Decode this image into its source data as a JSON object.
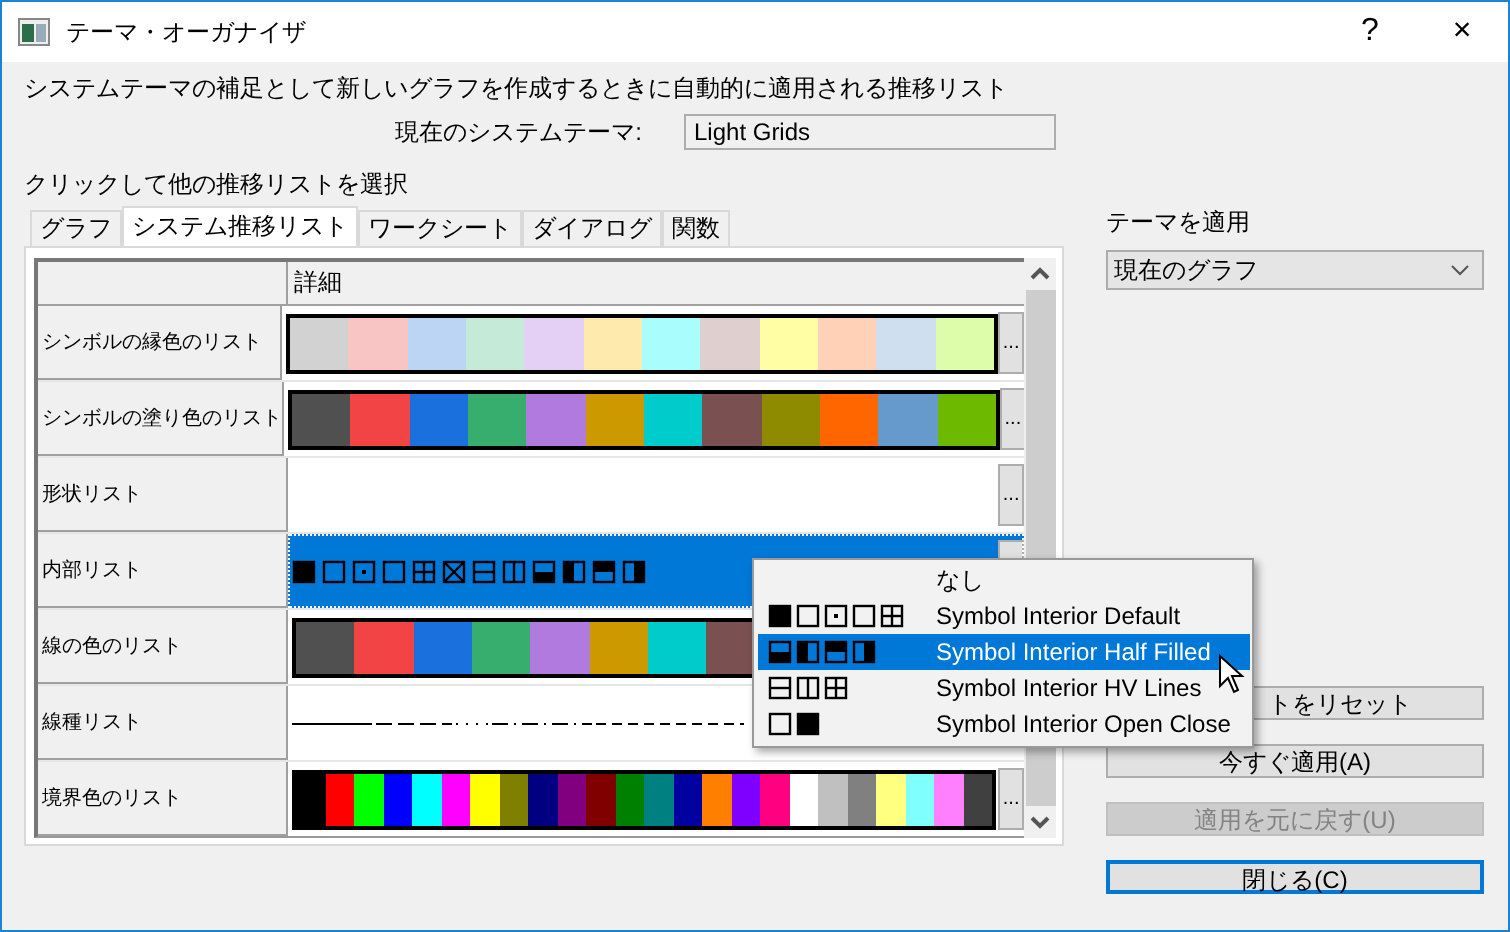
{
  "window": {
    "title": "テーマ・オーガナイザ",
    "help": "?",
    "close": "×"
  },
  "description": "システムテーマの補足として新しいグラフを作成するときに自動的に適用される推移リスト",
  "current_theme": {
    "label": "現在のシステムテーマ:",
    "value": "Light Grids"
  },
  "instruction": "クリックして他の推移リストを選択",
  "tabs": [
    {
      "label": "グラフ",
      "selected": false
    },
    {
      "label": "システム推移リスト",
      "selected": true
    },
    {
      "label": "ワークシート",
      "selected": false
    },
    {
      "label": "ダイアログ",
      "selected": false
    },
    {
      "label": "関数",
      "selected": false
    }
  ],
  "table": {
    "columns": [
      "詳細"
    ],
    "rows": [
      {
        "name": "シンボルの縁色のリスト",
        "kind": "colors",
        "selected": false,
        "more": "...",
        "swatches": [
          {
            "color": "#d2d2d2"
          },
          {
            "color": "#f9c4c4"
          },
          {
            "color": "#bcd5f4"
          },
          {
            "color": "#c5ead7"
          },
          {
            "color": "#e3d0f4"
          },
          {
            "color": "#feeaad"
          },
          {
            "color": "#a9fdfd"
          },
          {
            "color": "#dfcfcf"
          },
          {
            "color": "#fffea4"
          },
          {
            "color": "#ffd2b8"
          },
          {
            "color": "#d0dff0"
          },
          {
            "color": "#ddfdaa"
          }
        ]
      },
      {
        "name": "シンボルの塗り色のリスト",
        "kind": "colors",
        "selected": false,
        "more": "...",
        "swatches": [
          {
            "color": "#505050"
          },
          {
            "color": "#f24444"
          },
          {
            "color": "#1a70dd"
          },
          {
            "color": "#37ae6d"
          },
          {
            "color": "#b07ade"
          },
          {
            "color": "#cc9900"
          },
          {
            "color": "#00cccc"
          },
          {
            "color": "#7a5050"
          },
          {
            "color": "#8f8b00"
          },
          {
            "color": "#ff6600"
          },
          {
            "color": "#6699cc"
          },
          {
            "color": "#6cb900"
          }
        ]
      },
      {
        "name": "形状リスト",
        "kind": "blank",
        "selected": false,
        "more": "..."
      },
      {
        "name": "内部リスト",
        "kind": "symbols",
        "selected": true,
        "more_button": true,
        "symbols": [
          {
            "kind": "filled"
          },
          {
            "kind": "open"
          },
          {
            "kind": "dot"
          },
          {
            "kind": "open"
          },
          {
            "kind": "grid"
          },
          {
            "kind": "cross"
          },
          {
            "kind": "hline"
          },
          {
            "kind": "vline"
          },
          {
            "kind": "bottom"
          },
          {
            "kind": "left"
          },
          {
            "kind": "top"
          },
          {
            "kind": "right"
          }
        ]
      },
      {
        "name": "線の色のリスト",
        "kind": "colors",
        "selected": false,
        "swatches": [
          {
            "color": "#505050"
          },
          {
            "color": "#f24444"
          },
          {
            "color": "#1a70dd"
          },
          {
            "color": "#37ae6d"
          },
          {
            "color": "#b07ade"
          },
          {
            "color": "#cc9900"
          },
          {
            "color": "#00cccc"
          },
          {
            "color": "#7a5050"
          }
        ]
      },
      {
        "name": "線種リスト",
        "kind": "linetypes",
        "selected": false
      },
      {
        "name": "境界色のリスト",
        "kind": "colors",
        "selected": false,
        "more": "...",
        "swatches": [
          {
            "color": "#000000"
          },
          {
            "color": "#ff0000"
          },
          {
            "color": "#00ff00"
          },
          {
            "color": "#0000ff"
          },
          {
            "color": "#00ffff"
          },
          {
            "color": "#ff00ff"
          },
          {
            "color": "#ffff00"
          },
          {
            "color": "#808000"
          },
          {
            "color": "#000080"
          },
          {
            "color": "#800080"
          },
          {
            "color": "#800000"
          },
          {
            "color": "#008000"
          },
          {
            "color": "#008080"
          },
          {
            "color": "#0000a0"
          },
          {
            "color": "#ff8000"
          },
          {
            "color": "#8000ff"
          },
          {
            "color": "#ff0080"
          },
          {
            "color": "#ffffff"
          },
          {
            "color": "#c0c0c0"
          },
          {
            "color": "#808080"
          },
          {
            "color": "#ffff80"
          },
          {
            "color": "#80ffff"
          },
          {
            "color": "#ff80ff"
          },
          {
            "color": "#404040"
          }
        ]
      }
    ]
  },
  "popup": [
    {
      "label": "なし",
      "selected": false
    },
    {
      "label": "Symbol Interior Default",
      "selected": false,
      "symbols": [
        {
          "kind": "filled"
        },
        {
          "kind": "open"
        },
        {
          "kind": "dot"
        },
        {
          "kind": "open"
        },
        {
          "kind": "grid"
        }
      ]
    },
    {
      "label": "Symbol Interior Half Filled",
      "selected": true,
      "symbols": [
        {
          "kind": "bottom"
        },
        {
          "kind": "left"
        },
        {
          "kind": "top"
        },
        {
          "kind": "right"
        }
      ]
    },
    {
      "label": "Symbol Interior HV Lines",
      "selected": false,
      "symbols": [
        {
          "kind": "hline"
        },
        {
          "kind": "vline"
        },
        {
          "kind": "grid"
        }
      ]
    },
    {
      "label": "Symbol Interior Open Close",
      "selected": false,
      "symbols": [
        {
          "kind": "open"
        },
        {
          "kind": "filled"
        }
      ]
    }
  ],
  "apply": {
    "label": "テーマを適用",
    "dropdown": "現在のグラフ"
  },
  "buttons": [
    {
      "label": "トをリセット",
      "disabled": false,
      "focused": false
    },
    {
      "label": "今すぐ適用(A)",
      "disabled": false,
      "focused": false
    },
    {
      "label": "適用を元に戻す(U)",
      "disabled": true,
      "focused": false
    },
    {
      "label": "閉じる(C)",
      "disabled": false,
      "focused": true
    }
  ]
}
